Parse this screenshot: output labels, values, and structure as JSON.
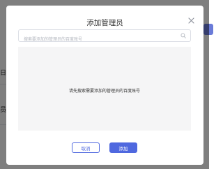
{
  "background": {
    "fragments": [
      "日",
      "员"
    ]
  },
  "dialog": {
    "title": "添加管理员",
    "search": {
      "placeholder": "搜索要添加的管理员的百度账号",
      "value": ""
    },
    "empty_message": "请先搜索需要添加的管理员的百度账号",
    "buttons": {
      "cancel": "取消",
      "add": "添加"
    }
  },
  "colors": {
    "primary": "#4f68df",
    "overlay": "rgba(0,0,0,0.5)",
    "result_bg": "#f5f5f6"
  },
  "icons": {
    "close": "close-icon",
    "search": "search-icon"
  }
}
